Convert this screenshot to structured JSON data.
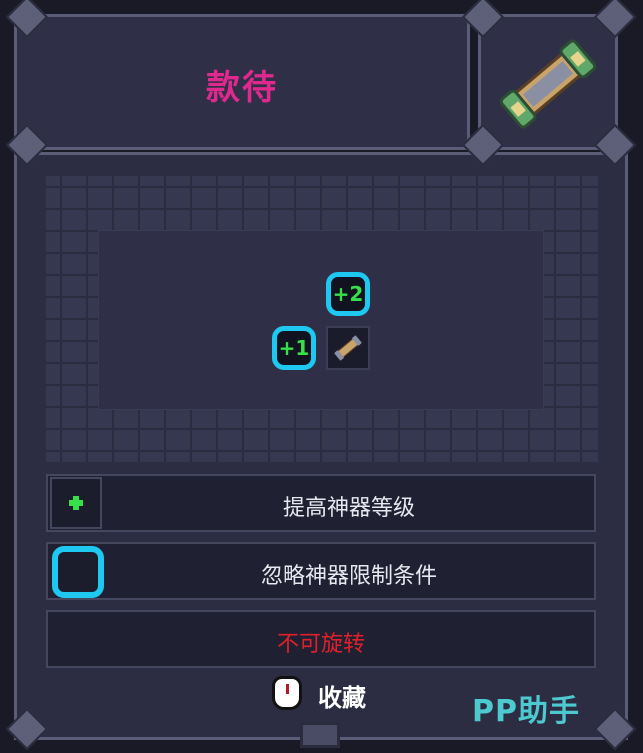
{
  "header": {
    "title": "款待",
    "title_color": "#e0288f",
    "item_icon": "relic-scroll-icon"
  },
  "preview": {
    "bubble_top": "+2",
    "bubble_left": "+1",
    "bubble_color": "#1ec8f0",
    "bonus_text_color": "#35e04a",
    "center_icon": "relic-scroll-icon"
  },
  "effects": [
    {
      "icon": "plus-icon",
      "label": "提高神器等级"
    },
    {
      "icon": "cyan-ring-icon",
      "label": "忽略神器限制条件"
    }
  ],
  "warning": {
    "label": "不可旋转",
    "color": "#e0202a"
  },
  "favorite": {
    "icon": "mouse-icon",
    "label": "收藏"
  },
  "watermark": "PP助手"
}
